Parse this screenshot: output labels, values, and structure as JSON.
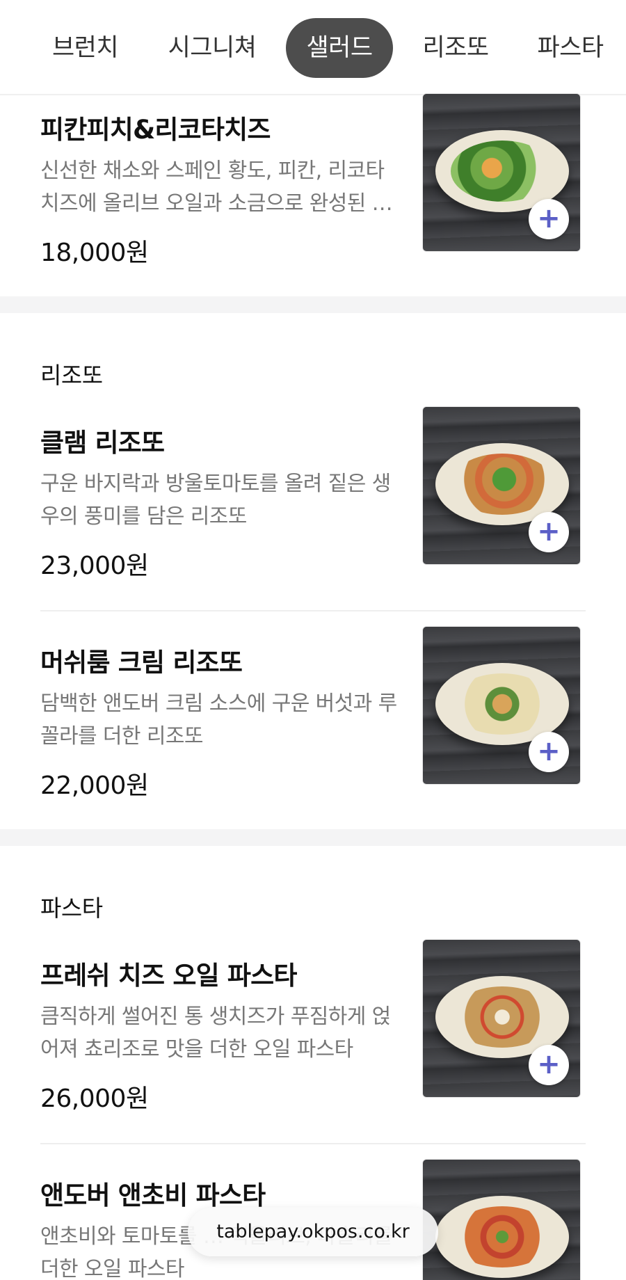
{
  "tabs": [
    {
      "label": "브런치",
      "active": false
    },
    {
      "label": "시그니쳐",
      "active": false
    },
    {
      "label": "샐러드",
      "active": true
    },
    {
      "label": "리조또",
      "active": false
    },
    {
      "label": "파스타",
      "active": false
    }
  ],
  "items": [
    {
      "name": "피칸피치&리코타치즈",
      "description": "신선한 채소와 스페인 황도, 피칸, 리코타 치즈에 올리브 오일과 소금으로 완성된 …",
      "price": "18,000원",
      "image": "salad-dish-photo"
    },
    {
      "name": "클램 리조또",
      "description": "구운 바지락과 방울토마토를 올려 짙은 생우의 풍미를 담은 리조또",
      "price": "23,000원",
      "image": "clam-risotto-photo"
    },
    {
      "name": "머쉬룸 크림 리조또",
      "description": "담백한 앤도버 크림 소스에 구운 버섯과 루꼴라를 더한 리조또",
      "price": "22,000원",
      "image": "mushroom-risotto-photo"
    },
    {
      "name": "프레쉬 치즈 오일 파스타",
      "description": "큼직하게 썰어진 통 생치즈가 푸짐하게 얹어져 쵸리조로 맛을 더한 오일 파스타",
      "price": "26,000원",
      "image": "cheese-pasta-photo"
    },
    {
      "name": "앤도버 앤초비 파스타",
      "description": "앤초비와 토마토를 … 랙올리브, 파슬리를 더한 오일 파스타",
      "price": "",
      "image": "anchovy-pasta-photo"
    }
  ],
  "sections": {
    "risotto_title": "리조또",
    "pasta_title": "파스타"
  },
  "add_button_glyph": "+",
  "url_bar": {
    "text": "tablepay.okpos.co.kr"
  },
  "colors": {
    "accent": "#5b5fc7",
    "active_tab_bg": "#4d4d4d",
    "description_text": "#777777",
    "section_gap": "#f4f4f5"
  }
}
